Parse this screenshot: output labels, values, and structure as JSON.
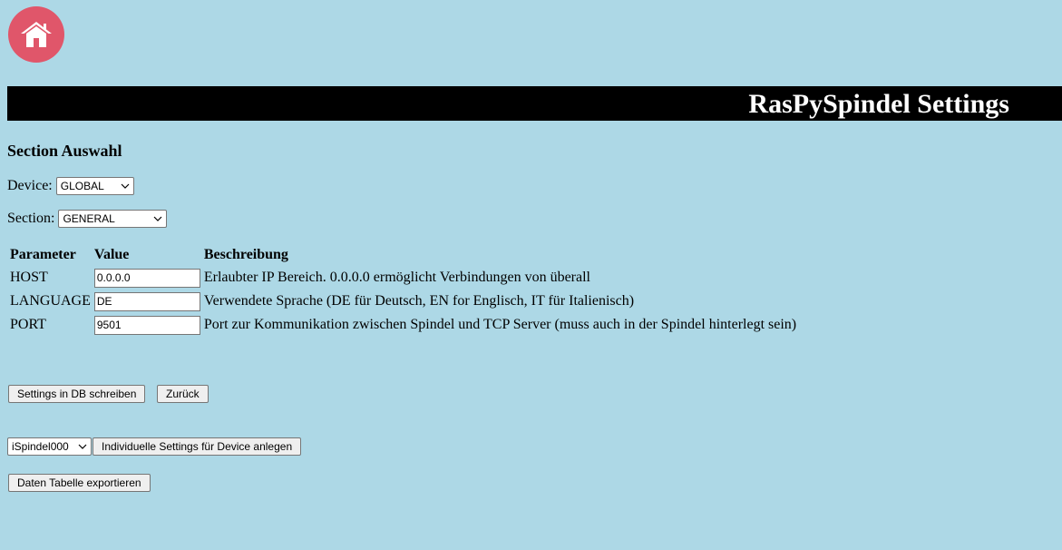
{
  "header": {
    "home_icon": "home-icon",
    "home_color": "#e0566a",
    "title": "RasPySpindel Settings"
  },
  "section_select": {
    "heading": "Section Auswahl",
    "device_label": "Device:",
    "device_value": "GLOBAL",
    "section_label": "Section:",
    "section_value": "GENERAL"
  },
  "params_table": {
    "headers": [
      "Parameter",
      "Value",
      "Beschreibung"
    ],
    "rows": [
      {
        "parameter": "HOST",
        "value": "0.0.0.0",
        "description": "Erlaubter IP Bereich. 0.0.0.0 ermöglicht Verbindungen von überall"
      },
      {
        "parameter": "LANGUAGE",
        "value": "DE",
        "description": "Verwendete Sprache (DE für Deutsch, EN for Englisch, IT für Italienisch)"
      },
      {
        "parameter": "PORT",
        "value": "9501",
        "description": "Port zur Kommunikation zwischen Spindel und TCP Server (muss auch in der Spindel hinterlegt sein)"
      }
    ]
  },
  "actions": {
    "write_settings_label": "Settings in DB schreiben",
    "back_label": "Zurück",
    "device_select_value": "iSpindel000",
    "create_device_settings_label": "Individuelle Settings für Device anlegen",
    "export_label": "Daten Tabelle exportieren"
  },
  "colors": {
    "background": "#add8e6",
    "title_bar": "#000000",
    "title_text": "#ffffff"
  }
}
